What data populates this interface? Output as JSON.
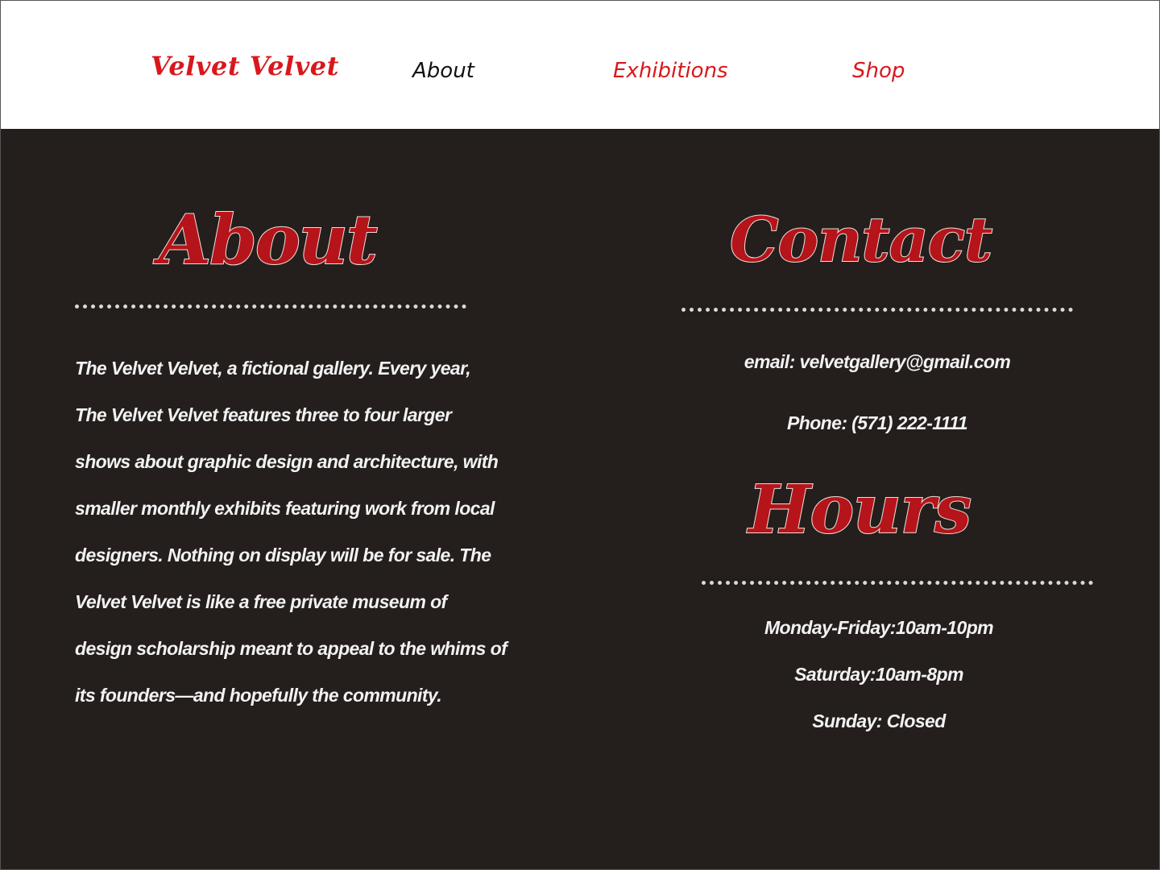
{
  "header": {
    "logo": "Velvet Velvet",
    "nav": [
      {
        "label": "About"
      },
      {
        "label": "Exhibitions"
      },
      {
        "label": "Shop"
      }
    ]
  },
  "about": {
    "heading": "About",
    "lines": [
      "The Velvet Velvet, a fictional gallery. Every year,",
      "The Velvet Velvet features three to four larger",
      "shows about graphic design and architecture, with",
      "smaller monthly exhibits featuring work from local",
      "designers. Nothing on display will be for sale. The",
      "Velvet Velvet is like a free private museum of",
      "design scholarship meant to appeal to the whims of",
      "its founders—and hopefully the community."
    ]
  },
  "contact": {
    "heading": "Contact",
    "email": "email: velvetgallery@gmail.com",
    "phone": "Phone: (571) 222-1111"
  },
  "hours": {
    "heading": "Hours",
    "lines": [
      "Monday-Friday:10am-10pm",
      "Saturday:10am-8pm",
      "Sunday: Closed"
    ]
  },
  "colors": {
    "brand_red": "#d9171c",
    "heading_red": "#b5141a",
    "background_dark": "#241e1d",
    "text_light": "#f2f2f2"
  }
}
